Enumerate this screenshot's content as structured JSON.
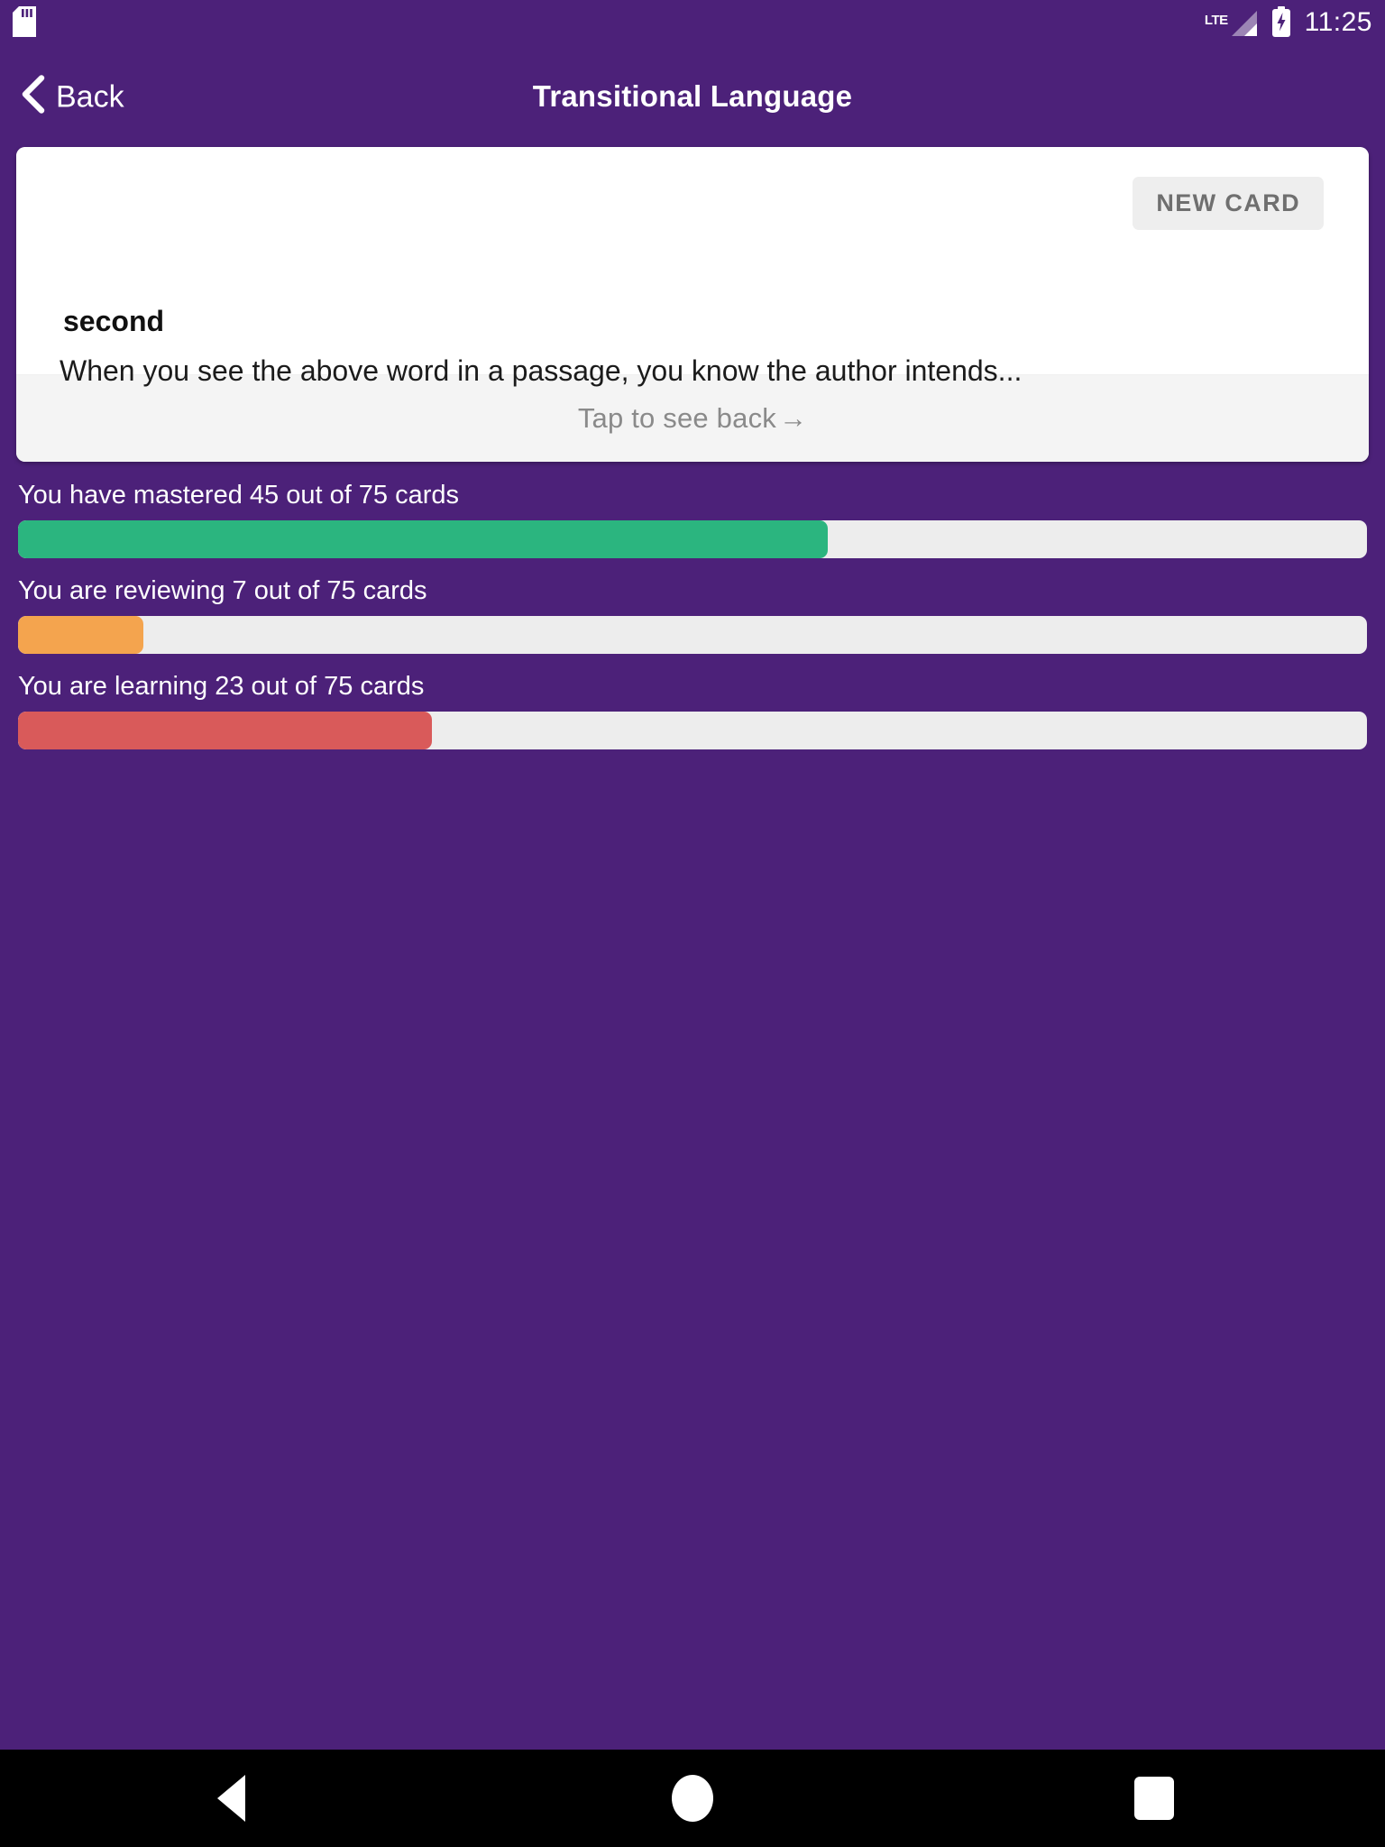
{
  "theme": {
    "background": "#4c2179",
    "card_bg": "#ffffff",
    "card_footer_bg": "#f4f4f4",
    "track_bg": "#ededed",
    "mastered_color": "#2bb57f",
    "reviewing_color": "#f4a44e",
    "learning_color": "#d95a5a",
    "navbar_bg": "#000000"
  },
  "status_bar": {
    "sd_icon": "sd-card-icon",
    "network_label": "LTE",
    "signal_icon": "signal-bars-icon",
    "battery_icon": "battery-charging-icon",
    "time": "11:25"
  },
  "app_bar": {
    "back_icon": "chevron-left-icon",
    "back_label": "Back",
    "title": "Transitional Language"
  },
  "flashcard": {
    "badge_label": "NEW CARD",
    "term": "second",
    "prompt": "When you see the above word in a passage, you know the author intends...",
    "footer_label": "Tap to see back",
    "footer_arrow": "→"
  },
  "progress": {
    "groups": [
      {
        "label": "You have mastered 45 out of 75 cards",
        "value": 45,
        "total": 75,
        "percent": 60,
        "color": "#2bb57f",
        "state": "mastered"
      },
      {
        "label": "You are reviewing 7 out of 75 cards",
        "value": 7,
        "total": 75,
        "percent": 9.3,
        "color": "#f4a44e",
        "state": "reviewing"
      },
      {
        "label": "You are learning 23 out of 75 cards",
        "value": 23,
        "total": 75,
        "percent": 30.7,
        "color": "#d95a5a",
        "state": "learning"
      }
    ]
  },
  "nav_bar": {
    "back_icon": "triangle-back-icon",
    "home_icon": "circle-home-icon",
    "recents_icon": "square-recents-icon"
  }
}
